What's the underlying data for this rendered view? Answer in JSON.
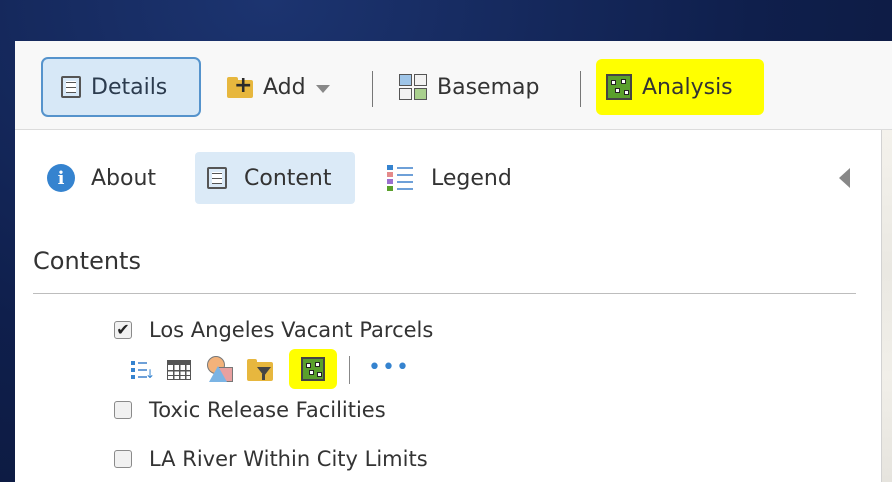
{
  "toolbar": {
    "details_label": "Details",
    "add_label": "Add",
    "basemap_label": "Basemap",
    "analysis_label": "Analysis"
  },
  "tabs": {
    "about_label": "About",
    "content_label": "Content",
    "legend_label": "Legend"
  },
  "contents": {
    "title": "Contents",
    "layers": [
      {
        "name": "Los Angeles Vacant Parcels",
        "checked": true
      },
      {
        "name": "Toxic Release Facilities",
        "checked": false
      },
      {
        "name": "LA River Within City Limits",
        "checked": false
      }
    ],
    "more_glyph": "•••"
  },
  "colors": {
    "highlight": "#ffff00",
    "selected_tab": "#dbeaf7",
    "accent_blue": "#3583cf",
    "folder": "#e7b73e",
    "analysis_green": "#5aa02c"
  },
  "icons": {
    "details": "document-list-icon",
    "add": "folder-plus-icon",
    "basemap": "basemap-grid-icon",
    "analysis": "analysis-icon",
    "about": "info-icon",
    "content": "document-list-icon",
    "legend": "legend-list-icon"
  }
}
